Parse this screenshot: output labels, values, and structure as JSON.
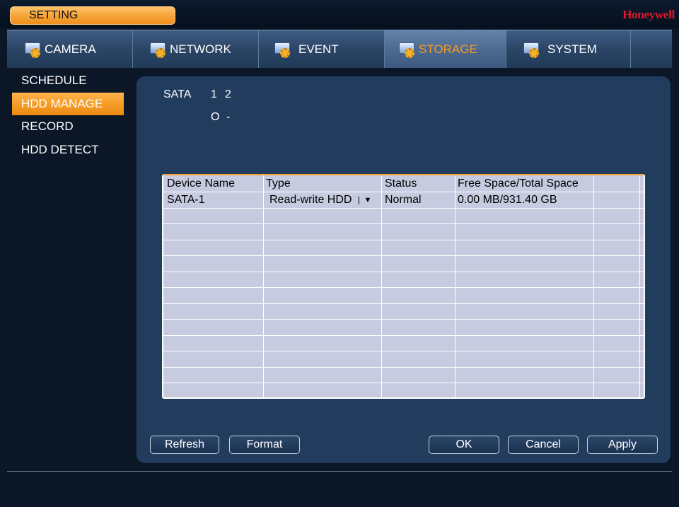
{
  "window": {
    "title": "SETTING",
    "brand": "Honeywell"
  },
  "tabs": [
    {
      "label": "CAMERA",
      "icon": "camera-gear-icon",
      "active": false
    },
    {
      "label": "NETWORK",
      "icon": "network-gear-icon",
      "active": false
    },
    {
      "label": "EVENT",
      "icon": "event-gear-icon",
      "active": false
    },
    {
      "label": "STORAGE",
      "icon": "storage-gear-icon",
      "active": true
    },
    {
      "label": "SYSTEM",
      "icon": "system-gear-icon",
      "active": false
    }
  ],
  "sidebar": {
    "items": [
      {
        "label": "SCHEDULE",
        "active": false
      },
      {
        "label": "HDD MANAGE",
        "active": true
      },
      {
        "label": "RECORD",
        "active": false
      },
      {
        "label": "HDD DETECT",
        "active": false
      }
    ]
  },
  "sata": {
    "label": "SATA",
    "ports": [
      "1",
      "2"
    ],
    "states": [
      "O",
      "-"
    ]
  },
  "table": {
    "columns": [
      "Device Name",
      "Type",
      "Status",
      "Free Space/Total Space"
    ],
    "rows": [
      {
        "device": "SATA-1",
        "type": "Read-write HDD",
        "status": "Normal",
        "space": "0.00 MB/931.40 GB"
      }
    ]
  },
  "buttons": {
    "refresh": "Refresh",
    "format": "Format",
    "ok": "OK",
    "cancel": "Cancel",
    "apply": "Apply"
  },
  "colors": {
    "accent": "#f59b25",
    "panel": "#223c5d",
    "brand": "#e3152a"
  }
}
